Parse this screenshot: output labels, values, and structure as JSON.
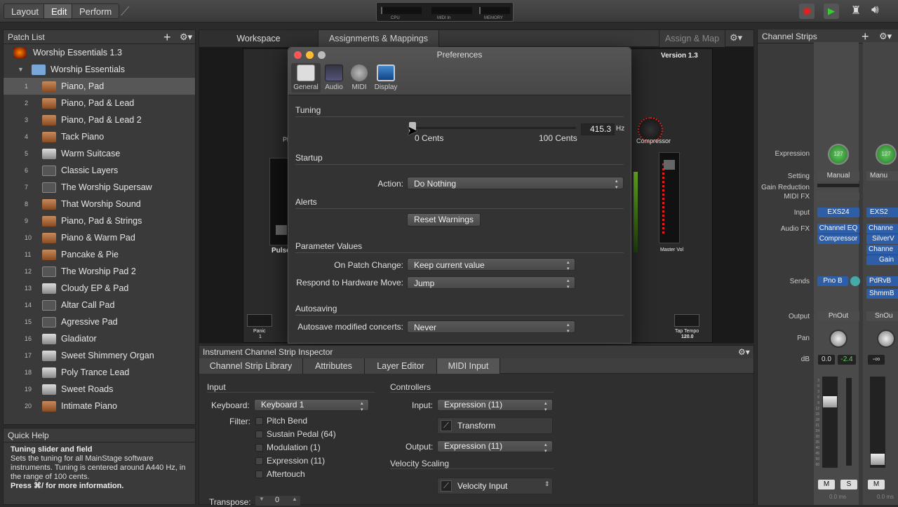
{
  "topbar": {
    "modes": [
      "Layout",
      "Edit",
      "Perform"
    ],
    "active_mode": "Edit",
    "meter_labels": [
      "CPU",
      "MIDI In",
      "MEMORY"
    ]
  },
  "patch_list": {
    "title": "Patch List",
    "concert": "Worship Essentials 1.3",
    "set": "Worship Essentials",
    "patches": [
      {
        "num": "1",
        "label": "Piano, Pad",
        "icon": "piano"
      },
      {
        "num": "2",
        "label": "Piano, Pad & Lead",
        "icon": "piano"
      },
      {
        "num": "3",
        "label": "Piano, Pad & Lead 2",
        "icon": "piano"
      },
      {
        "num": "4",
        "label": "Tack Piano",
        "icon": "piano"
      },
      {
        "num": "5",
        "label": "Warm Suitcase",
        "icon": "keys"
      },
      {
        "num": "6",
        "label": "Classic Layers",
        "icon": "synth"
      },
      {
        "num": "7",
        "label": "The Worship Supersaw",
        "icon": "synth"
      },
      {
        "num": "8",
        "label": "That Worship Sound",
        "icon": "piano"
      },
      {
        "num": "9",
        "label": "Piano, Pad & Strings",
        "icon": "piano"
      },
      {
        "num": "10",
        "label": "Piano & Warm Pad",
        "icon": "piano"
      },
      {
        "num": "11",
        "label": "Pancake & Pie",
        "icon": "piano"
      },
      {
        "num": "12",
        "label": "The Worship Pad 2",
        "icon": "synth"
      },
      {
        "num": "13",
        "label": "Cloudy EP & Pad",
        "icon": "keys"
      },
      {
        "num": "14",
        "label": "Altar Call Pad",
        "icon": "synth"
      },
      {
        "num": "15",
        "label": "Agressive Pad",
        "icon": "synth"
      },
      {
        "num": "16",
        "label": "Gladiator",
        "icon": "keys"
      },
      {
        "num": "17",
        "label": "Sweet Shimmery Organ",
        "icon": "keys"
      },
      {
        "num": "18",
        "label": "Poly Trance Lead",
        "icon": "keys"
      },
      {
        "num": "19",
        "label": "Sweet Roads",
        "icon": "keys"
      },
      {
        "num": "20",
        "label": "Intimate Piano",
        "icon": "piano"
      }
    ]
  },
  "quick_help": {
    "title": "Quick Help",
    "heading": "Tuning slider and field",
    "body": "Sets the tuning for all MainStage software instruments. Tuning is centered around A440 Hz, in the range of 100 cents.",
    "footer": "Press ⌘/ for more information."
  },
  "workspace": {
    "tabs": [
      "Workspace",
      "Assignments & Mappings"
    ],
    "assign_map": "Assign & Map",
    "version": "Version 1.3",
    "labels": {
      "compressor": "Compressor",
      "pulse": "Pulse",
      "master_vol": "Master Vol",
      "panic": "Panic",
      "panic_num": "1",
      "tap_tempo": "Tap Tempo",
      "tempo": "120.0",
      "pl": "Pl"
    }
  },
  "preferences": {
    "title": "Preferences",
    "tabs": [
      "General",
      "Audio",
      "MIDI",
      "Display"
    ],
    "tuning": {
      "section": "Tuning",
      "min_label": "0 Cents",
      "max_label": "100 Cents",
      "value": "415.3",
      "unit": "Hz"
    },
    "startup": {
      "section": "Startup",
      "action_label": "Action:",
      "action_value": "Do Nothing"
    },
    "alerts": {
      "section": "Alerts",
      "reset_button": "Reset Warnings"
    },
    "parameter_values": {
      "section": "Parameter Values",
      "on_patch_change_label": "On Patch Change:",
      "on_patch_change_value": "Keep current value",
      "hw_move_label": "Respond to Hardware Move:",
      "hw_move_value": "Jump"
    },
    "autosaving": {
      "section": "Autosaving",
      "label": "Autosave modified concerts:",
      "value": "Never"
    }
  },
  "inspector": {
    "title": "Instrument Channel Strip Inspector",
    "tabs": [
      "Channel Strip Library",
      "Attributes",
      "Layer Editor",
      "MIDI Input"
    ],
    "input": {
      "section": "Input",
      "keyboard_label": "Keyboard:",
      "keyboard_value": "Keyboard 1",
      "filter_label": "Filter:",
      "filters": [
        "Pitch Bend",
        "Sustain Pedal (64)",
        "Modulation (1)",
        "Expression (11)",
        "Aftertouch"
      ],
      "transpose_label": "Transpose:",
      "transpose_value": "0"
    },
    "controllers": {
      "section": "Controllers",
      "input_label": "Input:",
      "input_value": "Expression (11)",
      "transform": "Transform",
      "output_label": "Output:",
      "output_value": "Expression (11)"
    },
    "velocity": {
      "section": "Velocity Scaling",
      "value": "Velocity Input"
    }
  },
  "channel_strips": {
    "title": "Channel Strips",
    "row_labels": {
      "expression": "Expression",
      "setting": "Setting",
      "gain_reduction": "Gain Reduction",
      "midi_fx": "MIDI FX",
      "input": "Input",
      "audio_fx": "Audio FX",
      "sends": "Sends",
      "output": "Output",
      "pan": "Pan",
      "db": "dB"
    },
    "strip1": {
      "expression": "127",
      "setting": "Manual",
      "input": "EXS24",
      "fx": [
        "Channel EQ",
        "Compressor"
      ],
      "send": "Pno B",
      "output": "PnOut",
      "db_left": "0.0",
      "db_right": "-2.4",
      "mute": "M",
      "solo": "S",
      "time": "0.0 ms"
    },
    "strip2": {
      "expression": "127",
      "setting": "Manu",
      "input": "EXS2",
      "fx": [
        "Channe",
        "SilverV",
        "Channe",
        "Gain"
      ],
      "sends": [
        "PdRvB",
        "ShmmB"
      ],
      "output": "SnOu",
      "db_left": "-∞",
      "mute": "M",
      "time": "0.0 ms"
    },
    "fader_scale": [
      "3",
      "0",
      "3",
      "6",
      "9",
      "12",
      "15",
      "18",
      "21",
      "24",
      "30",
      "35",
      "40",
      "45",
      "50",
      "60"
    ]
  }
}
